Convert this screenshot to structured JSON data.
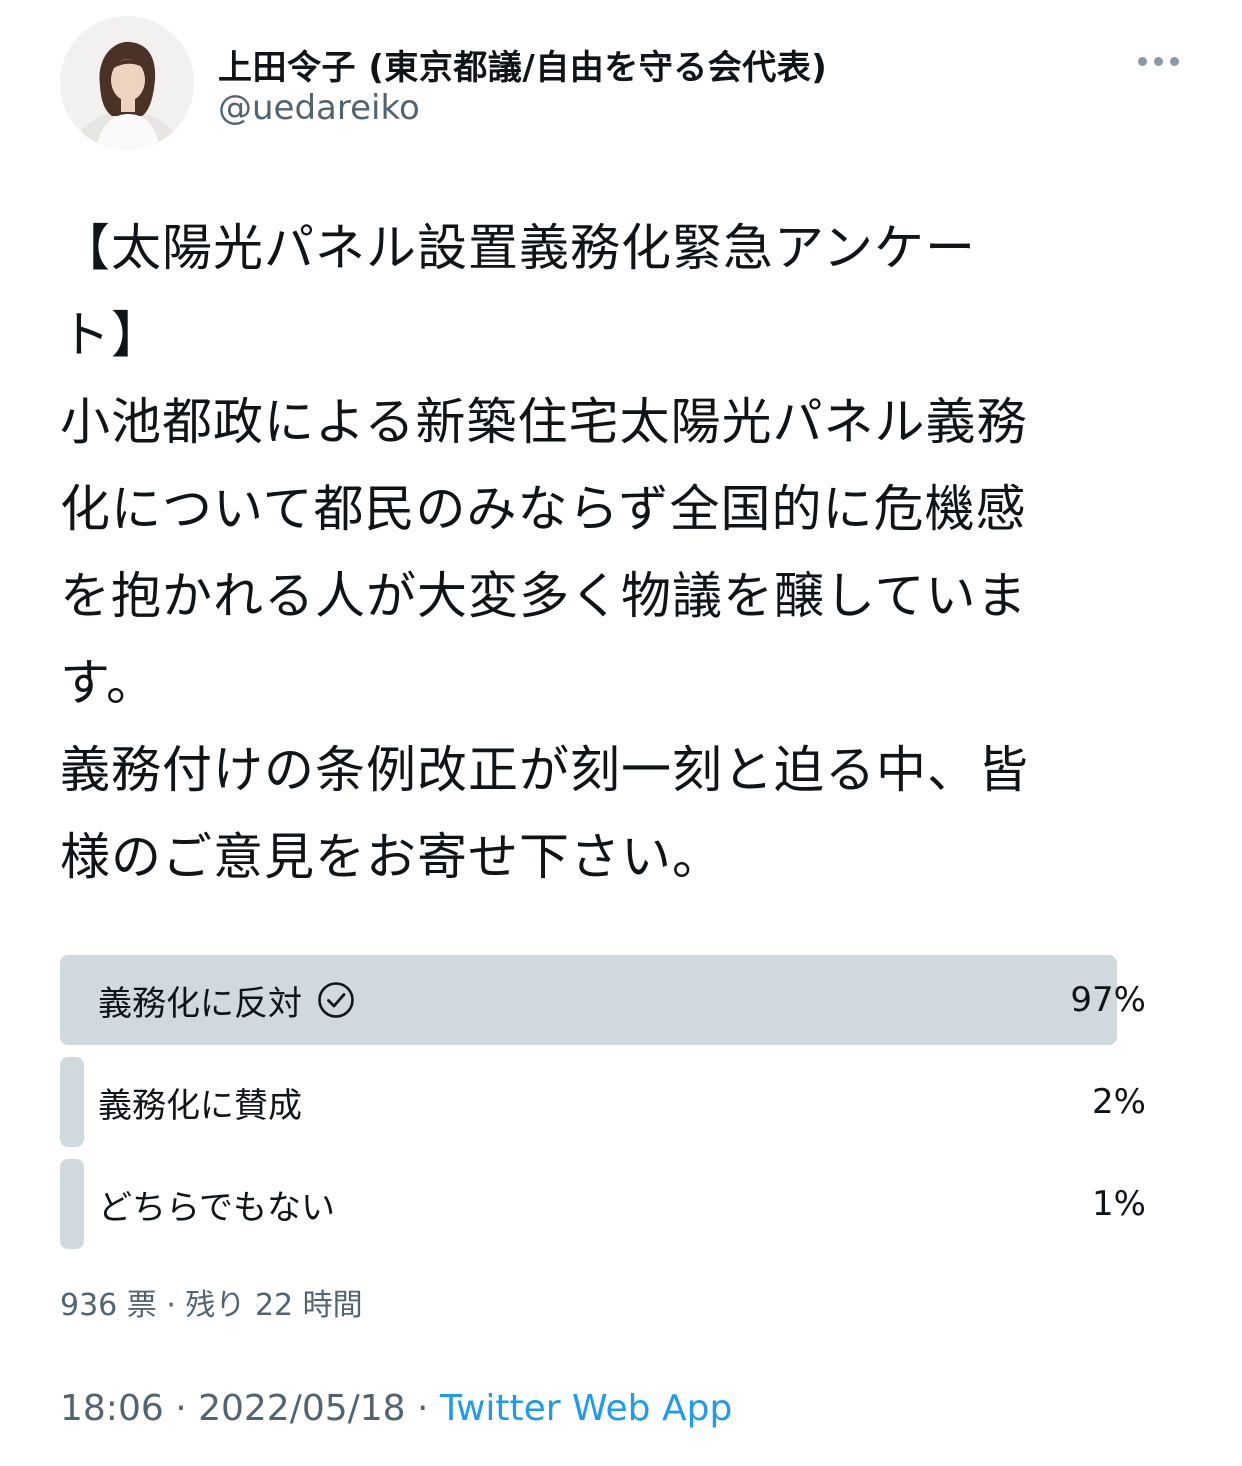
{
  "author": {
    "display_name": "上田令子 (東京都議/自由を守る会代表)",
    "handle": "@uedareiko"
  },
  "tweet": {
    "text": "【太陽光パネル設置義務化緊急アンケー\nト】\n小池都政による新築住宅太陽光パネル義務\n化について都民のみならず全国的に危機感\nを抱かれる人が大変多く物議を醸していま\nす。\n義務付けの条例改正が刻一刻と迫る中、皆\n様のご意見をお寄せ下さい。"
  },
  "poll": {
    "options": [
      {
        "label": "義務化に反対",
        "percent_text": "97%",
        "percent": 97,
        "selected": true
      },
      {
        "label": "義務化に賛成",
        "percent_text": "2%",
        "percent": 2,
        "selected": false
      },
      {
        "label": "どちらでもない",
        "percent_text": "1%",
        "percent": 1,
        "selected": false
      }
    ],
    "meta": "936 票 · 残り 22 時間"
  },
  "footer": {
    "time": "18:06",
    "sep1": " · ",
    "date": "2022/05/18",
    "sep2": " · ",
    "source": "Twitter Web App"
  },
  "colors": {
    "bar": "#cfd9de",
    "link": "#1d9bf0",
    "muted": "#536471"
  },
  "icons": {
    "more": "more-dots-icon",
    "check": "check-circle-icon"
  }
}
